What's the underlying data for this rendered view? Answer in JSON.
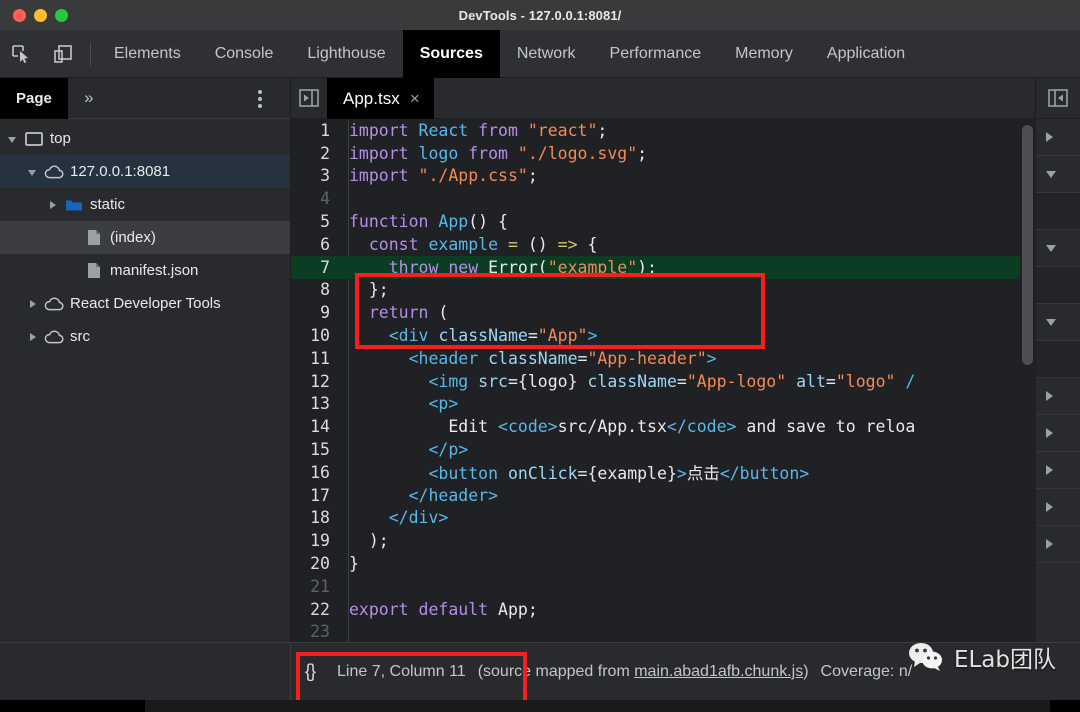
{
  "window": {
    "title": "DevTools - 127.0.0.1:8081/",
    "traffic_lights": [
      "close-red",
      "minimize-yellow",
      "maximize-green"
    ],
    "colors": {
      "red": "#ff5f57",
      "yellow": "#febc2e",
      "green": "#28c840"
    }
  },
  "toolbar": {
    "icons": [
      {
        "name": "inspect-element-icon",
        "title": "Inspect"
      },
      {
        "name": "device-toolbar-icon",
        "title": "Toggle device toolbar"
      }
    ],
    "tabs": [
      {
        "label": "Elements",
        "active": false
      },
      {
        "label": "Console",
        "active": false
      },
      {
        "label": "Lighthouse",
        "active": false
      },
      {
        "label": "Sources",
        "active": true
      },
      {
        "label": "Network",
        "active": false
      },
      {
        "label": "Performance",
        "active": false
      },
      {
        "label": "Memory",
        "active": false
      },
      {
        "label": "Application",
        "active": false
      }
    ]
  },
  "navigator": {
    "tab_label": "Page",
    "more_label": "»",
    "kebab_label": "More options",
    "tree": [
      {
        "label": "top",
        "indent": 0,
        "twisty": "down",
        "icon": "frame-icon",
        "state": "none"
      },
      {
        "label": "127.0.0.1:8081",
        "indent": 1,
        "twisty": "down",
        "icon": "cloud-icon",
        "state": "selected-blue"
      },
      {
        "label": "static",
        "indent": 2,
        "twisty": "right",
        "icon": "folder-icon",
        "state": "none"
      },
      {
        "label": "(index)",
        "indent": 3,
        "twisty": "none",
        "icon": "file-icon",
        "state": "selected-grey"
      },
      {
        "label": "manifest.json",
        "indent": 3,
        "twisty": "none",
        "icon": "file-icon",
        "state": "none"
      },
      {
        "label": "React Developer Tools",
        "indent": 1,
        "twisty": "right",
        "icon": "cloud-icon",
        "state": "none"
      },
      {
        "label": "src",
        "indent": 1,
        "twisty": "right",
        "icon": "cloud-icon",
        "state": "none"
      }
    ]
  },
  "editor": {
    "panel_toggle_name": "show-navigator-icon",
    "tab": {
      "filename": "App.tsx",
      "close_label": "×"
    },
    "execution_line": 7,
    "lines": [
      {
        "n": 1,
        "empty": false,
        "tokens": [
          {
            "t": "kw",
            "v": "import"
          },
          {
            "t": "plain",
            "v": " "
          },
          {
            "t": "id",
            "v": "React"
          },
          {
            "t": "plain",
            "v": " "
          },
          {
            "t": "kw",
            "v": "from"
          },
          {
            "t": "plain",
            "v": " "
          },
          {
            "t": "str",
            "v": "\"react\""
          },
          {
            "t": "punc",
            "v": ";"
          }
        ]
      },
      {
        "n": 2,
        "empty": false,
        "tokens": [
          {
            "t": "kw",
            "v": "import"
          },
          {
            "t": "plain",
            "v": " "
          },
          {
            "t": "id",
            "v": "logo"
          },
          {
            "t": "plain",
            "v": " "
          },
          {
            "t": "kw",
            "v": "from"
          },
          {
            "t": "plain",
            "v": " "
          },
          {
            "t": "str",
            "v": "\"./logo.svg\""
          },
          {
            "t": "punc",
            "v": ";"
          }
        ]
      },
      {
        "n": 3,
        "empty": false,
        "tokens": [
          {
            "t": "kw",
            "v": "import"
          },
          {
            "t": "plain",
            "v": " "
          },
          {
            "t": "str",
            "v": "\"./App.css\""
          },
          {
            "t": "punc",
            "v": ";"
          }
        ]
      },
      {
        "n": 4,
        "empty": true,
        "tokens": []
      },
      {
        "n": 5,
        "empty": false,
        "tokens": [
          {
            "t": "kw",
            "v": "function"
          },
          {
            "t": "plain",
            "v": " "
          },
          {
            "t": "id",
            "v": "App"
          },
          {
            "t": "punc",
            "v": "() {"
          }
        ]
      },
      {
        "n": 6,
        "empty": false,
        "tokens": [
          {
            "t": "plain",
            "v": "  "
          },
          {
            "t": "kw",
            "v": "const"
          },
          {
            "t": "plain",
            "v": " "
          },
          {
            "t": "id",
            "v": "example"
          },
          {
            "t": "plain",
            "v": " "
          },
          {
            "t": "op",
            "v": "="
          },
          {
            "t": "plain",
            "v": " "
          },
          {
            "t": "punc",
            "v": "()"
          },
          {
            "t": "plain",
            "v": " "
          },
          {
            "t": "op",
            "v": "=>"
          },
          {
            "t": "punc",
            "v": " {"
          }
        ]
      },
      {
        "n": 7,
        "empty": false,
        "tokens": [
          {
            "t": "plain",
            "v": "    "
          },
          {
            "t": "kw",
            "v": "throw"
          },
          {
            "t": "plain",
            "v": " "
          },
          {
            "t": "kw",
            "v": "new"
          },
          {
            "t": "plain",
            "v": " "
          },
          {
            "t": "plain",
            "v": "Error"
          },
          {
            "t": "punc",
            "v": "("
          },
          {
            "t": "str",
            "v": "\"example\""
          },
          {
            "t": "punc",
            "v": ");"
          }
        ]
      },
      {
        "n": 8,
        "empty": false,
        "tokens": [
          {
            "t": "plain",
            "v": "  "
          },
          {
            "t": "punc",
            "v": "};"
          }
        ]
      },
      {
        "n": 9,
        "empty": false,
        "tokens": [
          {
            "t": "plain",
            "v": "  "
          },
          {
            "t": "kw",
            "v": "return"
          },
          {
            "t": "punc",
            "v": " ("
          }
        ]
      },
      {
        "n": 10,
        "empty": false,
        "tokens": [
          {
            "t": "plain",
            "v": "    "
          },
          {
            "t": "tag",
            "v": "<div"
          },
          {
            "t": "plain",
            "v": " "
          },
          {
            "t": "attr",
            "v": "className"
          },
          {
            "t": "punc",
            "v": "="
          },
          {
            "t": "str",
            "v": "\"App\""
          },
          {
            "t": "tag",
            "v": ">"
          }
        ]
      },
      {
        "n": 11,
        "empty": false,
        "tokens": [
          {
            "t": "plain",
            "v": "      "
          },
          {
            "t": "tag",
            "v": "<header"
          },
          {
            "t": "plain",
            "v": " "
          },
          {
            "t": "attr",
            "v": "className"
          },
          {
            "t": "punc",
            "v": "="
          },
          {
            "t": "str",
            "v": "\"App-header\""
          },
          {
            "t": "tag",
            "v": ">"
          }
        ]
      },
      {
        "n": 12,
        "empty": false,
        "tokens": [
          {
            "t": "plain",
            "v": "        "
          },
          {
            "t": "tag",
            "v": "<img"
          },
          {
            "t": "plain",
            "v": " "
          },
          {
            "t": "attr",
            "v": "src"
          },
          {
            "t": "punc",
            "v": "={"
          },
          {
            "t": "plain",
            "v": "logo"
          },
          {
            "t": "punc",
            "v": "}"
          },
          {
            "t": "plain",
            "v": " "
          },
          {
            "t": "attr",
            "v": "className"
          },
          {
            "t": "punc",
            "v": "="
          },
          {
            "t": "str",
            "v": "\"App-logo\""
          },
          {
            "t": "plain",
            "v": " "
          },
          {
            "t": "attr",
            "v": "alt"
          },
          {
            "t": "punc",
            "v": "="
          },
          {
            "t": "str",
            "v": "\"logo\""
          },
          {
            "t": "plain",
            "v": " "
          },
          {
            "t": "tag",
            "v": "/"
          }
        ]
      },
      {
        "n": 13,
        "empty": false,
        "tokens": [
          {
            "t": "plain",
            "v": "        "
          },
          {
            "t": "tag",
            "v": "<p>"
          }
        ]
      },
      {
        "n": 14,
        "empty": false,
        "tokens": [
          {
            "t": "plain",
            "v": "          Edit "
          },
          {
            "t": "tag",
            "v": "<code>"
          },
          {
            "t": "plain",
            "v": "src/App.tsx"
          },
          {
            "t": "tag",
            "v": "</code>"
          },
          {
            "t": "plain",
            "v": " and save to reloa"
          }
        ]
      },
      {
        "n": 15,
        "empty": false,
        "tokens": [
          {
            "t": "plain",
            "v": "        "
          },
          {
            "t": "tag",
            "v": "</p>"
          }
        ]
      },
      {
        "n": 16,
        "empty": false,
        "tokens": [
          {
            "t": "plain",
            "v": "        "
          },
          {
            "t": "tag",
            "v": "<button"
          },
          {
            "t": "plain",
            "v": " "
          },
          {
            "t": "attr",
            "v": "onClick"
          },
          {
            "t": "punc",
            "v": "={"
          },
          {
            "t": "plain",
            "v": "example"
          },
          {
            "t": "punc",
            "v": "}"
          },
          {
            "t": "tag",
            "v": ">"
          },
          {
            "t": "plain",
            "v": "点击"
          },
          {
            "t": "tag",
            "v": "</button>"
          }
        ]
      },
      {
        "n": 17,
        "empty": false,
        "tokens": [
          {
            "t": "plain",
            "v": "      "
          },
          {
            "t": "tag",
            "v": "</header>"
          }
        ]
      },
      {
        "n": 18,
        "empty": false,
        "tokens": [
          {
            "t": "plain",
            "v": "    "
          },
          {
            "t": "tag",
            "v": "</div>"
          }
        ]
      },
      {
        "n": 19,
        "empty": false,
        "tokens": [
          {
            "t": "plain",
            "v": "  "
          },
          {
            "t": "punc",
            "v": ");"
          }
        ]
      },
      {
        "n": 20,
        "empty": false,
        "tokens": [
          {
            "t": "punc",
            "v": "}"
          }
        ]
      },
      {
        "n": 21,
        "empty": true,
        "tokens": []
      },
      {
        "n": 22,
        "empty": false,
        "tokens": [
          {
            "t": "kw",
            "v": "export"
          },
          {
            "t": "plain",
            "v": " "
          },
          {
            "t": "kw",
            "v": "default"
          },
          {
            "t": "plain",
            "v": " "
          },
          {
            "t": "plain",
            "v": "App"
          },
          {
            "t": "punc",
            "v": ";"
          }
        ]
      },
      {
        "n": 23,
        "empty": true,
        "tokens": []
      }
    ]
  },
  "debugger_sidebar": {
    "toggle_name": "show-debugger-icon",
    "sections": [
      {
        "state": "collapsed"
      },
      {
        "state": "expanded"
      },
      {
        "state": "expanded"
      },
      {
        "state": "expanded"
      },
      {
        "state": "collapsed"
      },
      {
        "state": "collapsed"
      },
      {
        "state": "collapsed"
      },
      {
        "state": "collapsed"
      },
      {
        "state": "collapsed"
      }
    ]
  },
  "statusbar": {
    "format_icon": "{}",
    "line_column": "Line 7, Column 11",
    "source_map_prefix": "(source mapped from ",
    "source_map_link": "main.abad1afb.chunk.js",
    "source_map_suffix": ")",
    "coverage": "Coverage: n/"
  },
  "annotations": {
    "highlight_color": "#f42020",
    "boxes": [
      {
        "name": "code-highlight-box",
        "target": "lines 6-8"
      },
      {
        "name": "status-highlight-box",
        "target": "Line 7, Column 11"
      }
    ]
  },
  "watermark": {
    "text": "ELab团队",
    "icon": "wechat-logo-icon"
  }
}
